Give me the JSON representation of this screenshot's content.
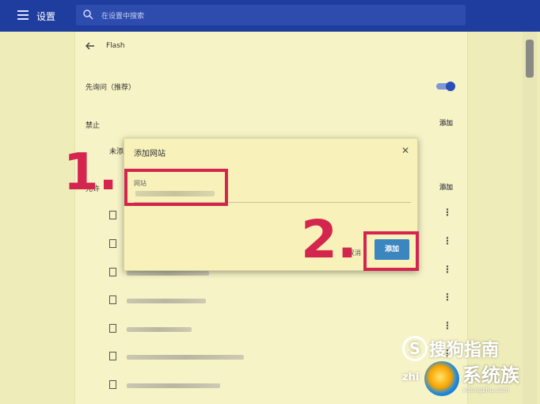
{
  "header": {
    "menu_icon": "menu-icon",
    "title": "设置",
    "search_placeholder": "在设置中搜索",
    "search_icon": "search-icon"
  },
  "flash": {
    "back_icon": "back-arrow-icon",
    "title": "Flash"
  },
  "settings": {
    "ask_first_label": "先询问（推荐）",
    "ask_first_on": true,
    "block_label": "禁止",
    "block_add": "添加",
    "block_partial_text": "未添",
    "allow_label": "允许",
    "allow_add": "添加"
  },
  "allow_list": {
    "items": [
      {
        "file_icon": "file-icon",
        "more_icon": "more-vertical-icon"
      },
      {
        "file_icon": "file-icon",
        "more_icon": "more-vertical-icon"
      },
      {
        "file_icon": "file-icon",
        "more_icon": "more-vertical-icon"
      },
      {
        "file_icon": "file-icon",
        "more_icon": "more-vertical-icon"
      },
      {
        "file_icon": "file-icon",
        "more_icon": "more-vertical-icon"
      },
      {
        "file_icon": "file-icon",
        "more_icon": "more-vertical-icon"
      },
      {
        "file_icon": "file-icon",
        "more_icon": "more-vertical-icon"
      }
    ]
  },
  "dialog": {
    "title": "添加网站",
    "close_icon": "close-icon",
    "field_label": "网站",
    "cancel": "取消",
    "add": "添加"
  },
  "annotations": {
    "step1": "1.",
    "step2": "2.",
    "color": "#d4254f"
  },
  "watermark": {
    "logo_icon": "sogou-logo-icon",
    "brand": "搜狗指南",
    "url_partial": "zhi",
    "site_logo_icon": "xitongzu-logo-icon",
    "site_name": "系统族",
    "site_url": "xitongzhu.com"
  },
  "colors": {
    "topbar": "#1f3d9e",
    "accent": "#2a4db8",
    "button": "#3b86bf",
    "annotation": "#d4254f"
  }
}
